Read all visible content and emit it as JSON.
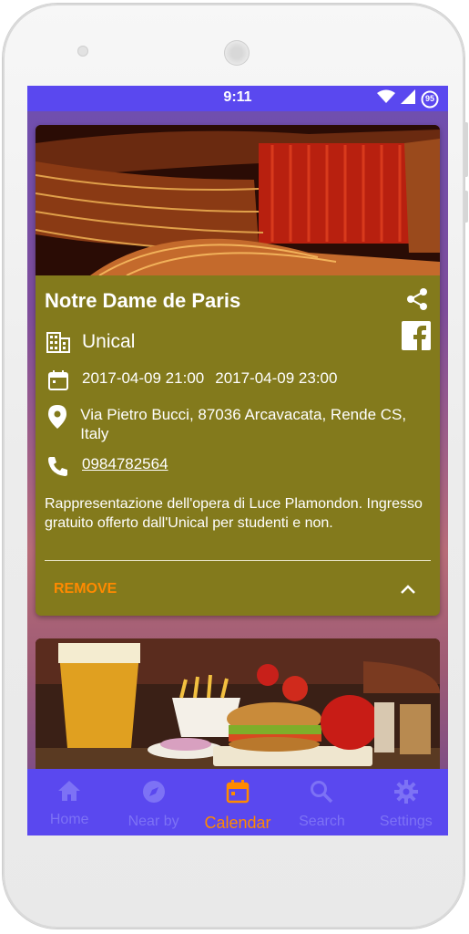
{
  "status_bar": {
    "time": "9:11",
    "battery_level": "95"
  },
  "event": {
    "title": "Notre Dame de Paris",
    "venue": "Unical",
    "start": "2017-04-09 21:00",
    "end": "2017-04-09 23:00",
    "address": "Via Pietro Bucci, 87036 Arcavacata, Rende CS, Italy",
    "phone": "0984782564",
    "description": "Rappresentazione dell'opera di Luce Plamondon. Ingresso gratuito offerto dall'Unical per studenti e non.",
    "remove_label": "REMOVE"
  },
  "nav": {
    "items": [
      {
        "label": "Home",
        "icon": "home-icon"
      },
      {
        "label": "Near by",
        "icon": "compass-icon"
      },
      {
        "label": "Calendar",
        "icon": "calendar-icon"
      },
      {
        "label": "Search",
        "icon": "search-icon"
      },
      {
        "label": "Settings",
        "icon": "gear-icon"
      }
    ],
    "active": "Calendar"
  },
  "colors": {
    "primary": "#5a48ef",
    "card": "#837a1c",
    "accent": "#ff8a00",
    "nav_inactive": "#7d72f5"
  }
}
